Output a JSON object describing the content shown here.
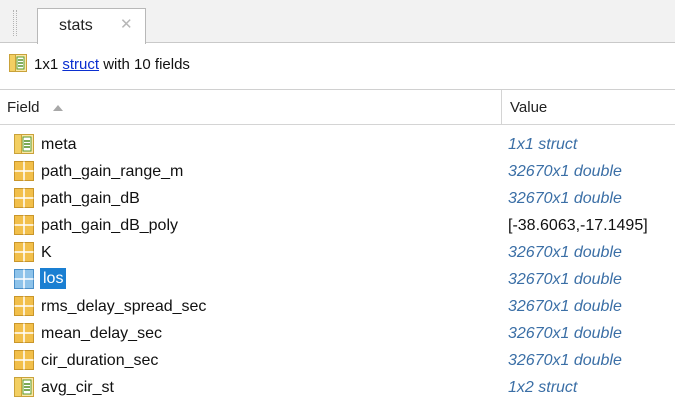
{
  "tab": {
    "label": "stats",
    "close_glyph": "✕"
  },
  "summary": {
    "prefix": "1x1 ",
    "link": "struct",
    "suffix": " with 10 fields"
  },
  "header": {
    "field": "Field",
    "value": "Value"
  },
  "rows": [
    {
      "name": "meta",
      "value": "1x1 struct",
      "icon": "struct-icon",
      "selected": false,
      "meta": true
    },
    {
      "name": "path_gain_range_m",
      "value": "32670x1 double",
      "icon": "matrix-icon",
      "selected": false,
      "meta": true
    },
    {
      "name": "path_gain_dB",
      "value": "32670x1 double",
      "icon": "matrix-icon",
      "selected": false,
      "meta": true
    },
    {
      "name": "path_gain_dB_poly",
      "value": "[-38.6063,-17.1495]",
      "icon": "matrix-icon",
      "selected": false,
      "meta": false
    },
    {
      "name": "K",
      "value": "32670x1 double",
      "icon": "matrix-icon",
      "selected": false,
      "meta": true
    },
    {
      "name": "los",
      "value": "32670x1 double",
      "icon": "matrix-icon",
      "selected": true,
      "meta": true
    },
    {
      "name": "rms_delay_spread_sec",
      "value": "32670x1 double",
      "icon": "matrix-icon",
      "selected": false,
      "meta": true
    },
    {
      "name": "mean_delay_sec",
      "value": "32670x1 double",
      "icon": "matrix-icon",
      "selected": false,
      "meta": true
    },
    {
      "name": "cir_duration_sec",
      "value": "32670x1 double",
      "icon": "matrix-icon",
      "selected": false,
      "meta": true
    },
    {
      "name": "avg_cir_st",
      "value": "1x2 struct",
      "icon": "struct-icon",
      "selected": false,
      "meta": true
    }
  ],
  "colors": {
    "selection": "#1a7fd2",
    "link": "#0b2fd0",
    "meta_text": "#3b6fa6",
    "matrix_icon": "#f2bf4a",
    "struct_icon": "#79b33a"
  }
}
